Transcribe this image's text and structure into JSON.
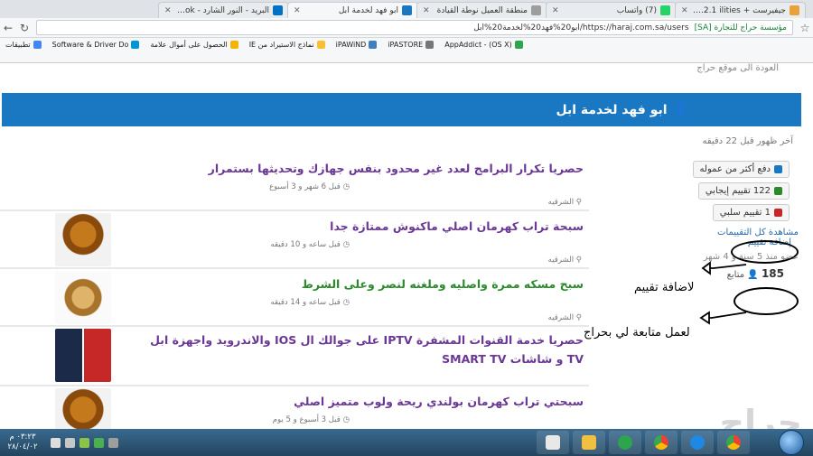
{
  "tabs": [
    {
      "label": "جيفيرست + Su 10.2.1 ilities",
      "color": "#e9a13a",
      "active": false
    },
    {
      "label": "(7) واتساب",
      "color": "#25d366",
      "active": false
    },
    {
      "label": "منطقة العميل نوطة القيادة",
      "color": "#9e9e9e",
      "active": false
    },
    {
      "label": "ابو فهد لخدمة ابل",
      "color": "#1a78c2",
      "active": true
    },
    {
      "label": "البريد - النور الشارد - utlook",
      "color": "#0072c6",
      "active": false
    }
  ],
  "address": {
    "secure_label": "مؤسسة حراج للتجارة [SA]",
    "url": "https://haraj.com.sa/users/ابو20%فهد20%لخدمة20%ابل"
  },
  "bookmarks": [
    {
      "label": "تطبيقات",
      "color": "#4285f4"
    },
    {
      "label": "Software & Driver Do",
      "color": "#0096d6"
    },
    {
      "label": "الحصول على أموال علامة",
      "color": "#f4b400"
    },
    {
      "label": "نماذج الاستيراد من IE",
      "color": "#fbc02d"
    },
    {
      "label": "iPAWiND",
      "color": "#3f7fbf"
    },
    {
      "label": "iPASTORE",
      "color": "#777777"
    },
    {
      "label": "(OS X) - AppAddict",
      "color": "#2ea44f"
    }
  ],
  "page": {
    "back_link": "العودة الى موقع حراج",
    "title": "ابو فهد لخدمة ابل",
    "last_seen": "آخر ظهور قبل 22 دقيقه"
  },
  "sidebar": {
    "commission": "دفع أكثر من عموله",
    "positive": "122 تقييم إيجابي",
    "negative": "1 تقييم سلبي",
    "view_all": "مشاهدة كل التقييمات",
    "add_review": "إضافة تقييم",
    "member_since": "عضو منذ 5 سنة و 4 شهر",
    "followers_count": "185",
    "followers_label": "متابع"
  },
  "listings": [
    {
      "title": "حصريا تكرار البرامج لعدد غير محدود بنفس جهازك وتحديثها بستمرار",
      "time": "قبل 6 شهر و 3 أسبوع",
      "city": "الشرقيه",
      "green": false,
      "thumb": "apps"
    },
    {
      "title": "سبحة تراب كهرمان اصلي ماكنوش ممتازة جدا",
      "time": "قبل ساعه و 10 دقيقه",
      "city": "الشرقيه",
      "green": false,
      "thumb": "beads"
    },
    {
      "title": "سبح مسكه ممرة واصليه وملغنه لنصر وعلى الشرط",
      "time": "قبل ساعه و 14 دقيقه",
      "city": "الشرقيه",
      "green": true,
      "thumb": "beads2"
    },
    {
      "title": "حصريا خدمة القنوات المشفرة IPTV على جوالك ال IOS والاندرويد واجهزة ابل TV و شاشات SMART TV",
      "time": "",
      "city": "",
      "green": false,
      "thumb": "iptv"
    },
    {
      "title": "سبحتي تراب كهرمان بولندي ريحة ولوب متميز اصلي",
      "time": "قبل 3 أسبوع و 5 يوم",
      "city": "",
      "green": false,
      "thumb": "beads"
    }
  ],
  "annotations": {
    "add_review_note": "لاضافة تقييم",
    "follow_note": "لعمل متابعة لي بحراج"
  },
  "watermark": "حراج",
  "taskbar": {
    "time": "٠٣:٢٣ م",
    "date": "٢٨/٠٤/٠٢"
  }
}
